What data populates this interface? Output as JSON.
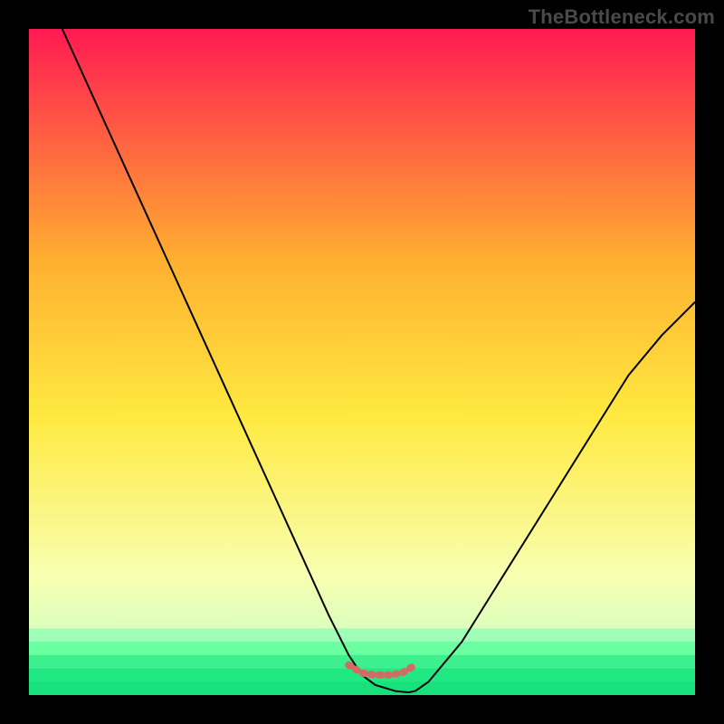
{
  "watermark": "TheBottleneck.com",
  "colors": {
    "gradient_top": "#ff1a52",
    "gradient_upper_mid": "#ffb030",
    "gradient_mid": "#ffe940",
    "gradient_lower_mid": "#f8ffb0",
    "gradient_low": "#d6ffbf",
    "gradient_bottom": "#18e07a",
    "curve": "#000000",
    "marker": "#d46a62"
  },
  "chart_data": {
    "type": "line",
    "title": "",
    "xlabel": "",
    "ylabel": "",
    "xlim": [
      0,
      100
    ],
    "ylim": [
      0,
      100
    ],
    "series": [
      {
        "name": "bottleneck-curve",
        "x": [
          5,
          10,
          15,
          20,
          25,
          30,
          35,
          40,
          45,
          48,
          50,
          52,
          55,
          57,
          58,
          60,
          65,
          70,
          75,
          80,
          85,
          90,
          95,
          100
        ],
        "y": [
          100,
          89,
          78,
          67,
          56,
          45,
          34,
          23,
          12,
          6,
          3,
          1.5,
          0.6,
          0.4,
          0.6,
          2,
          8,
          16,
          24,
          32,
          40,
          48,
          54,
          59
        ]
      },
      {
        "name": "marker-band",
        "x": [
          48,
          50,
          52,
          54,
          56,
          58
        ],
        "y": [
          4.5,
          3.3,
          3.0,
          3.0,
          3.3,
          4.5
        ]
      }
    ],
    "annotations": []
  }
}
